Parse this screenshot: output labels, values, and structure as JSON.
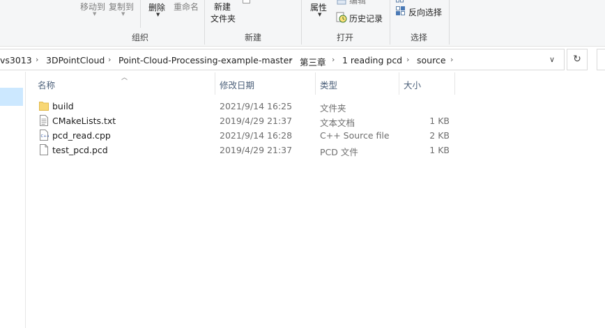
{
  "ribbon": {
    "organize": {
      "move_to": "移动到",
      "copy_to": "复制到",
      "delete": "删除",
      "rename": "重命名",
      "label": "组织"
    },
    "new": {
      "new_item_line1": "新建",
      "new_item_line2": "文件夹",
      "label": "新建"
    },
    "open": {
      "properties": "属性",
      "edit": "编辑",
      "history": "历史记录",
      "label": "打开"
    },
    "select": {
      "invert_selection": "反向选择",
      "label": "选择"
    }
  },
  "address": {
    "crumbs": [
      "vs3013",
      "3DPointCloud",
      "Point-Cloud-Processing-example-master",
      "第三章",
      "1 reading pcd",
      "source"
    ]
  },
  "columns": {
    "name": "名称",
    "modified": "修改日期",
    "type": "类型",
    "size": "大小"
  },
  "files": [
    {
      "name": "build",
      "modified": "2021/9/14 16:25",
      "type": "文件夹",
      "size": "",
      "icon": "folder-icon"
    },
    {
      "name": "CMakeLists.txt",
      "modified": "2019/4/29 21:37",
      "type": "文本文档",
      "size": "1 KB",
      "icon": "text-file-icon"
    },
    {
      "name": "pcd_read.cpp",
      "modified": "2021/9/14 16:28",
      "type": "C++ Source file",
      "size": "2 KB",
      "icon": "cpp-file-icon"
    },
    {
      "name": "test_pcd.pcd",
      "modified": "2019/4/29 21:37",
      "type": "PCD 文件",
      "size": "1 KB",
      "icon": "generic-file-icon"
    }
  ],
  "colors": {
    "selection": "#cce8ff",
    "folder": "#f8d775",
    "header_text": "#4c607a",
    "ribbon_bg": "#f5f6f7"
  }
}
